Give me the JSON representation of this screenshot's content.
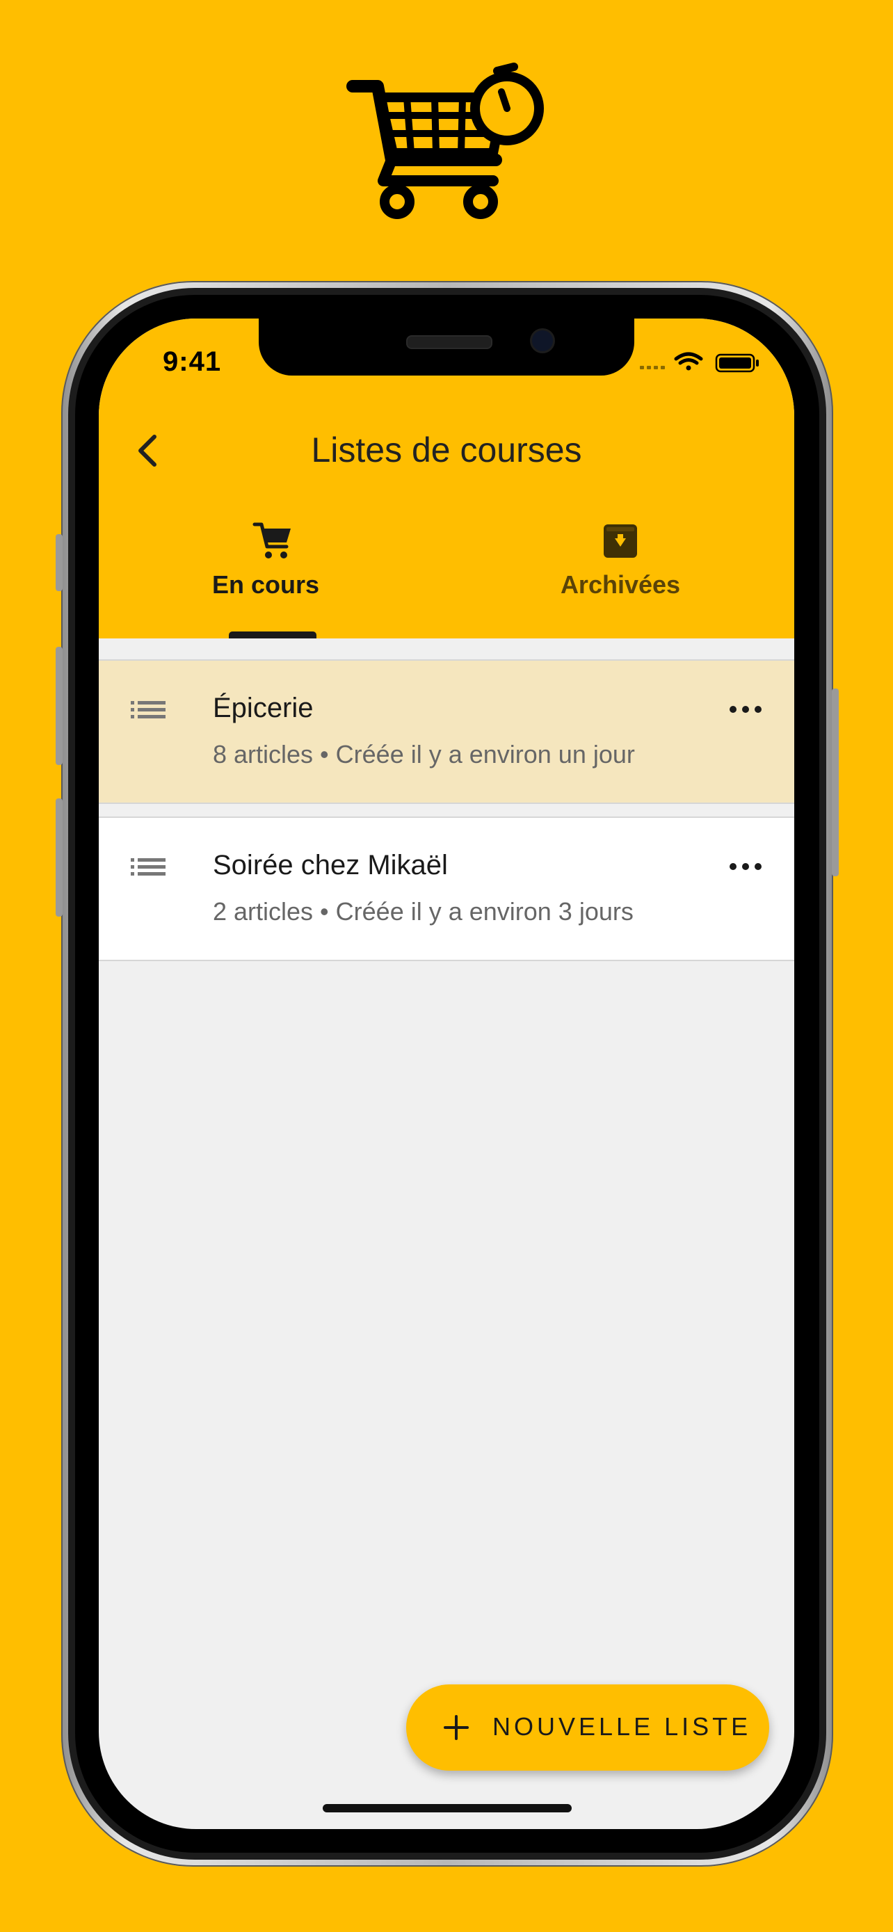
{
  "colors": {
    "brand_yellow": "#FFBE00",
    "highlight_row": "#F5E6BE",
    "screen_bg": "#F0F0F0"
  },
  "status_bar": {
    "time": "9:41",
    "icons": [
      "signal-icon",
      "wifi-icon",
      "battery-icon"
    ]
  },
  "header": {
    "title": "Listes de courses",
    "back_icon": "chevron-left-icon"
  },
  "tabs": [
    {
      "label": "En cours",
      "icon": "cart-icon",
      "selected": true
    },
    {
      "label": "Archivées",
      "icon": "archive-icon",
      "selected": false
    }
  ],
  "lists": [
    {
      "title": "Épicerie",
      "subtitle": "8 articles • Créée il y a environ un jour",
      "highlighted": true
    },
    {
      "title": "Soirée chez Mikaël",
      "subtitle": "2 articles • Créée il y a environ 3 jours",
      "highlighted": false
    }
  ],
  "fab": {
    "label": "NOUVELLE LISTE",
    "icon": "plus-icon"
  }
}
